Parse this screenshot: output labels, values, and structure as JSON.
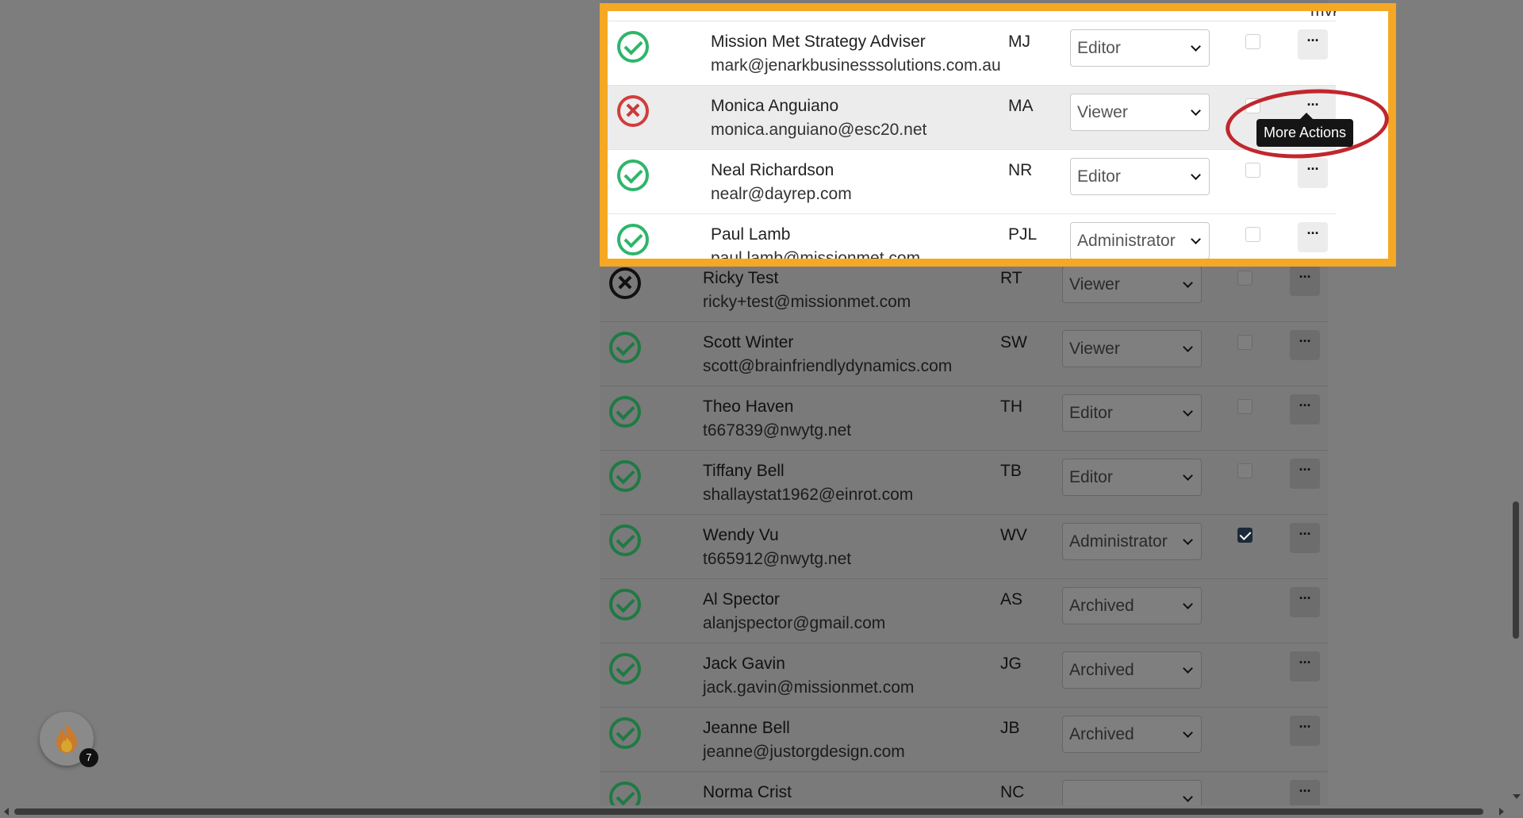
{
  "top_peek_email": "mvk@caasev.abb",
  "tooltip_text": "More Actions",
  "more_label": "···",
  "badge_count": "7",
  "colors": {
    "highlight_border": "#f5a823",
    "annotation_circle": "#c0272d",
    "status_ok": "#2fb56a",
    "status_error": "#d23c3c"
  },
  "highlighted_users": [
    {
      "name": "Mission Met Strategy Adviser",
      "email": "mark@jenarkbusinesssolutions.com.au",
      "initials": "MJ",
      "role": "Editor",
      "status": "active",
      "checked": false
    },
    {
      "name": "Monica Anguiano",
      "email": "monica.anguiano@esc20.net",
      "initials": "MA",
      "role": "Viewer",
      "status": "error",
      "checked": false
    },
    {
      "name": "Neal Richardson",
      "email": "nealr@dayrep.com",
      "initials": "NR",
      "role": "Editor",
      "status": "active",
      "checked": false
    },
    {
      "name": "Paul Lamb",
      "email": "paul.lamb@missionmet.com",
      "initials": "PJL",
      "role": "Administrator",
      "status": "active",
      "checked": false
    }
  ],
  "users": [
    {
      "name": "Ricky Test",
      "email": "ricky+test@missionmet.com",
      "initials": "RT",
      "role": "Viewer",
      "status": "inactive",
      "checked": false
    },
    {
      "name": "Scott Winter",
      "email": "scott@brainfriendlydynamics.com",
      "initials": "SW",
      "role": "Viewer",
      "status": "active",
      "checked": false
    },
    {
      "name": "Theo Haven",
      "email": "t667839@nwytg.net",
      "initials": "TH",
      "role": "Editor",
      "status": "active",
      "checked": false
    },
    {
      "name": "Tiffany Bell",
      "email": "shallaystat1962@einrot.com",
      "initials": "TB",
      "role": "Editor",
      "status": "active",
      "checked": false
    },
    {
      "name": "Wendy Vu",
      "email": "t665912@nwytg.net",
      "initials": "WV",
      "role": "Administrator",
      "status": "active",
      "checked": true
    },
    {
      "name": "Al Spector",
      "email": "alanjspector@gmail.com",
      "initials": "AS",
      "role": "Archived",
      "status": "active",
      "checked": null
    },
    {
      "name": "Jack Gavin",
      "email": "jack.gavin@missionmet.com",
      "initials": "JG",
      "role": "Archived",
      "status": "active",
      "checked": null
    },
    {
      "name": "Jeanne Bell",
      "email": "jeanne@justorgdesign.com",
      "initials": "JB",
      "role": "Archived",
      "status": "active",
      "checked": null
    },
    {
      "name": "Norma Crist",
      "email": "",
      "initials": "NC",
      "role": "",
      "status": "active",
      "checked": null
    }
  ]
}
